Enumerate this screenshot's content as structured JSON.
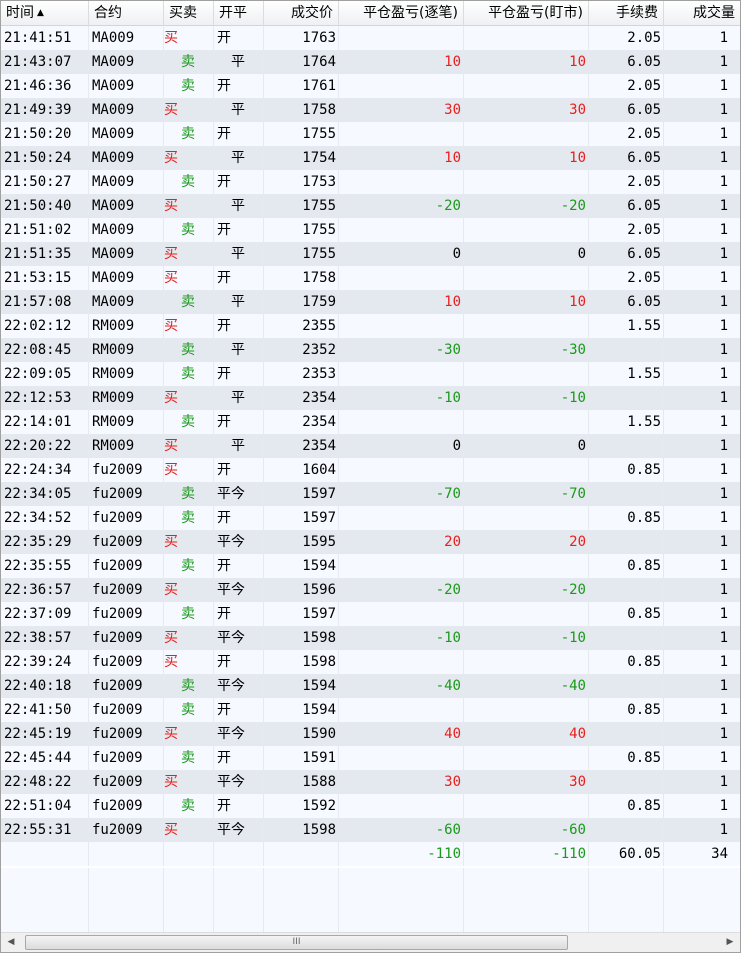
{
  "columns": {
    "time": "时间",
    "instrument": "合约",
    "direction": "买卖",
    "open_close": "开平",
    "price": "成交价",
    "pnl_by_trade": "平仓盈亏(逐笔)",
    "pnl_mark_to_market": "平仓盈亏(盯市)",
    "fee": "手续费",
    "volume": "成交量"
  },
  "sort_indicator": "▲",
  "rows": [
    {
      "time": "21:41:51",
      "inst": "MA009",
      "dir": "买",
      "oc": "开",
      "price": "1763",
      "pnl1": "",
      "pnl2": "",
      "fee": "2.05",
      "vol": "1"
    },
    {
      "time": "21:43:07",
      "inst": "MA009",
      "dir": "卖",
      "oc": "平",
      "price": "1764",
      "pnl1": "10",
      "pnl2": "10",
      "fee": "6.05",
      "vol": "1"
    },
    {
      "time": "21:46:36",
      "inst": "MA009",
      "dir": "卖",
      "oc": "开",
      "price": "1761",
      "pnl1": "",
      "pnl2": "",
      "fee": "2.05",
      "vol": "1"
    },
    {
      "time": "21:49:39",
      "inst": "MA009",
      "dir": "买",
      "oc": "平",
      "price": "1758",
      "pnl1": "30",
      "pnl2": "30",
      "fee": "6.05",
      "vol": "1"
    },
    {
      "time": "21:50:20",
      "inst": "MA009",
      "dir": "卖",
      "oc": "开",
      "price": "1755",
      "pnl1": "",
      "pnl2": "",
      "fee": "2.05",
      "vol": "1"
    },
    {
      "time": "21:50:24",
      "inst": "MA009",
      "dir": "买",
      "oc": "平",
      "price": "1754",
      "pnl1": "10",
      "pnl2": "10",
      "fee": "6.05",
      "vol": "1"
    },
    {
      "time": "21:50:27",
      "inst": "MA009",
      "dir": "卖",
      "oc": "开",
      "price": "1753",
      "pnl1": "",
      "pnl2": "",
      "fee": "2.05",
      "vol": "1"
    },
    {
      "time": "21:50:40",
      "inst": "MA009",
      "dir": "买",
      "oc": "平",
      "price": "1755",
      "pnl1": "-20",
      "pnl2": "-20",
      "fee": "6.05",
      "vol": "1"
    },
    {
      "time": "21:51:02",
      "inst": "MA009",
      "dir": "卖",
      "oc": "开",
      "price": "1755",
      "pnl1": "",
      "pnl2": "",
      "fee": "2.05",
      "vol": "1"
    },
    {
      "time": "21:51:35",
      "inst": "MA009",
      "dir": "买",
      "oc": "平",
      "price": "1755",
      "pnl1": "0",
      "pnl2": "0",
      "fee": "6.05",
      "vol": "1"
    },
    {
      "time": "21:53:15",
      "inst": "MA009",
      "dir": "买",
      "oc": "开",
      "price": "1758",
      "pnl1": "",
      "pnl2": "",
      "fee": "2.05",
      "vol": "1"
    },
    {
      "time": "21:57:08",
      "inst": "MA009",
      "dir": "卖",
      "oc": "平",
      "price": "1759",
      "pnl1": "10",
      "pnl2": "10",
      "fee": "6.05",
      "vol": "1"
    },
    {
      "time": "22:02:12",
      "inst": "RM009",
      "dir": "买",
      "oc": "开",
      "price": "2355",
      "pnl1": "",
      "pnl2": "",
      "fee": "1.55",
      "vol": "1"
    },
    {
      "time": "22:08:45",
      "inst": "RM009",
      "dir": "卖",
      "oc": "平",
      "price": "2352",
      "pnl1": "-30",
      "pnl2": "-30",
      "fee": "",
      "vol": "1"
    },
    {
      "time": "22:09:05",
      "inst": "RM009",
      "dir": "卖",
      "oc": "开",
      "price": "2353",
      "pnl1": "",
      "pnl2": "",
      "fee": "1.55",
      "vol": "1"
    },
    {
      "time": "22:12:53",
      "inst": "RM009",
      "dir": "买",
      "oc": "平",
      "price": "2354",
      "pnl1": "-10",
      "pnl2": "-10",
      "fee": "",
      "vol": "1"
    },
    {
      "time": "22:14:01",
      "inst": "RM009",
      "dir": "卖",
      "oc": "开",
      "price": "2354",
      "pnl1": "",
      "pnl2": "",
      "fee": "1.55",
      "vol": "1"
    },
    {
      "time": "22:20:22",
      "inst": "RM009",
      "dir": "买",
      "oc": "平",
      "price": "2354",
      "pnl1": "0",
      "pnl2": "0",
      "fee": "",
      "vol": "1"
    },
    {
      "time": "22:24:34",
      "inst": "fu2009",
      "dir": "买",
      "oc": "开",
      "price": "1604",
      "pnl1": "",
      "pnl2": "",
      "fee": "0.85",
      "vol": "1"
    },
    {
      "time": "22:34:05",
      "inst": "fu2009",
      "dir": "卖",
      "oc": "平今",
      "price": "1597",
      "pnl1": "-70",
      "pnl2": "-70",
      "fee": "",
      "vol": "1"
    },
    {
      "time": "22:34:52",
      "inst": "fu2009",
      "dir": "卖",
      "oc": "开",
      "price": "1597",
      "pnl1": "",
      "pnl2": "",
      "fee": "0.85",
      "vol": "1"
    },
    {
      "time": "22:35:29",
      "inst": "fu2009",
      "dir": "买",
      "oc": "平今",
      "price": "1595",
      "pnl1": "20",
      "pnl2": "20",
      "fee": "",
      "vol": "1"
    },
    {
      "time": "22:35:55",
      "inst": "fu2009",
      "dir": "卖",
      "oc": "开",
      "price": "1594",
      "pnl1": "",
      "pnl2": "",
      "fee": "0.85",
      "vol": "1"
    },
    {
      "time": "22:36:57",
      "inst": "fu2009",
      "dir": "买",
      "oc": "平今",
      "price": "1596",
      "pnl1": "-20",
      "pnl2": "-20",
      "fee": "",
      "vol": "1"
    },
    {
      "time": "22:37:09",
      "inst": "fu2009",
      "dir": "卖",
      "oc": "开",
      "price": "1597",
      "pnl1": "",
      "pnl2": "",
      "fee": "0.85",
      "vol": "1"
    },
    {
      "time": "22:38:57",
      "inst": "fu2009",
      "dir": "买",
      "oc": "平今",
      "price": "1598",
      "pnl1": "-10",
      "pnl2": "-10",
      "fee": "",
      "vol": "1"
    },
    {
      "time": "22:39:24",
      "inst": "fu2009",
      "dir": "买",
      "oc": "开",
      "price": "1598",
      "pnl1": "",
      "pnl2": "",
      "fee": "0.85",
      "vol": "1"
    },
    {
      "time": "22:40:18",
      "inst": "fu2009",
      "dir": "卖",
      "oc": "平今",
      "price": "1594",
      "pnl1": "-40",
      "pnl2": "-40",
      "fee": "",
      "vol": "1"
    },
    {
      "time": "22:41:50",
      "inst": "fu2009",
      "dir": "卖",
      "oc": "开",
      "price": "1594",
      "pnl1": "",
      "pnl2": "",
      "fee": "0.85",
      "vol": "1"
    },
    {
      "time": "22:45:19",
      "inst": "fu2009",
      "dir": "买",
      "oc": "平今",
      "price": "1590",
      "pnl1": "40",
      "pnl2": "40",
      "fee": "",
      "vol": "1"
    },
    {
      "time": "22:45:44",
      "inst": "fu2009",
      "dir": "卖",
      "oc": "开",
      "price": "1591",
      "pnl1": "",
      "pnl2": "",
      "fee": "0.85",
      "vol": "1"
    },
    {
      "time": "22:48:22",
      "inst": "fu2009",
      "dir": "买",
      "oc": "平今",
      "price": "1588",
      "pnl1": "30",
      "pnl2": "30",
      "fee": "",
      "vol": "1"
    },
    {
      "time": "22:51:04",
      "inst": "fu2009",
      "dir": "卖",
      "oc": "开",
      "price": "1592",
      "pnl1": "",
      "pnl2": "",
      "fee": "0.85",
      "vol": "1"
    },
    {
      "time": "22:55:31",
      "inst": "fu2009",
      "dir": "买",
      "oc": "平今",
      "price": "1598",
      "pnl1": "-60",
      "pnl2": "-60",
      "fee": "",
      "vol": "1"
    }
  ],
  "totals": {
    "pnl1": "-110",
    "pnl2": "-110",
    "fee": "60.05",
    "vol": "34"
  },
  "scrollbar": {
    "grip": "III",
    "left_arrow": "◀",
    "right_arrow": "▶"
  },
  "colors": {
    "buy": "#e8201e",
    "sell": "#1a9a1a",
    "positive": "#e8201e",
    "negative": "#1a9a1a"
  }
}
